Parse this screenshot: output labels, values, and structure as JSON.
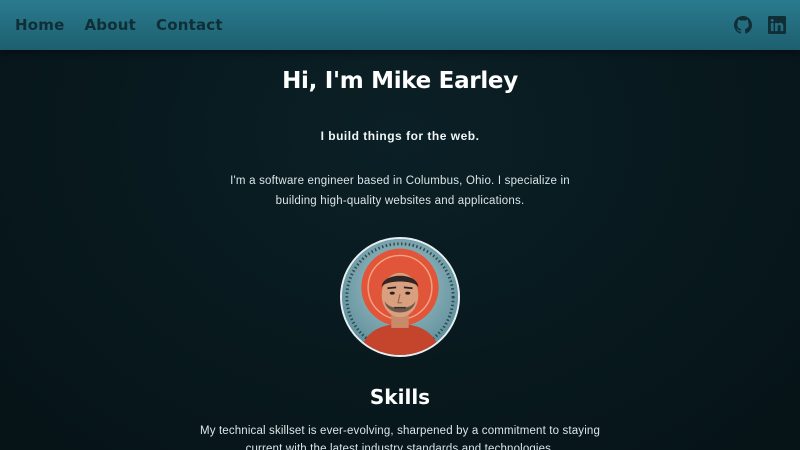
{
  "nav": {
    "items": [
      {
        "label": "Home"
      },
      {
        "label": "About"
      },
      {
        "label": "Contact"
      }
    ]
  },
  "social": {
    "github_icon": "github-icon",
    "linkedin_icon": "linkedin-icon"
  },
  "hero": {
    "title": "Hi, I'm Mike Earley",
    "tagline": "I build things for the web.",
    "intro": "I'm a software engineer based in Columbus, Ohio. I specialize in building high-quality websites and applications."
  },
  "skills": {
    "title": "Skills",
    "text": "My technical skillset is ever-evolving, sharpened by a commitment to staying current with the latest industry standards and technologies."
  },
  "colors": {
    "header": "#226a7c",
    "background": "#081a1f",
    "accent_orange": "#e1553a"
  }
}
